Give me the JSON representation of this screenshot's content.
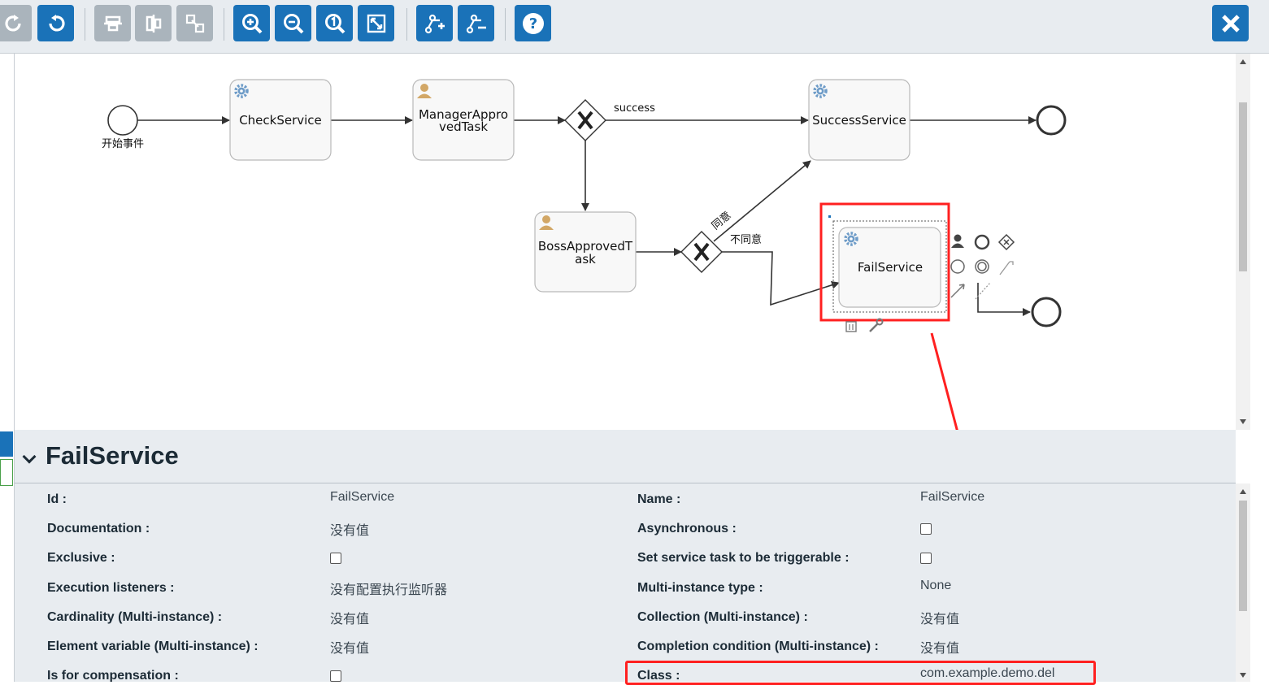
{
  "toolbar": {
    "buttons": [
      {
        "name": "redo-icon",
        "style": "grey"
      },
      {
        "name": "undo-icon",
        "style": "blue"
      },
      {
        "name": "align-horizontal-icon",
        "style": "grey"
      },
      {
        "name": "align-vertical-icon",
        "style": "grey"
      },
      {
        "name": "same-size-icon",
        "style": "grey"
      },
      {
        "name": "zoom-in-icon",
        "style": "blue"
      },
      {
        "name": "zoom-out-icon",
        "style": "blue"
      },
      {
        "name": "zoom-actual-icon",
        "style": "blue"
      },
      {
        "name": "zoom-fit-icon",
        "style": "blue"
      },
      {
        "name": "add-bendpoint-icon",
        "style": "blue"
      },
      {
        "name": "remove-bendpoint-icon",
        "style": "blue"
      },
      {
        "name": "help-icon",
        "style": "blue"
      }
    ],
    "close_icon": "close-icon"
  },
  "diagram": {
    "start_event_label": "开始事件",
    "nodes": {
      "check_service": "CheckService",
      "manager_task_line1": "ManagerAppro",
      "manager_task_line2": "vedTask",
      "boss_task_line1": "BossApprovedT",
      "boss_task_line2": "ask",
      "success_service": "SuccessService",
      "fail_service": "FailService"
    },
    "flows": {
      "success": "success",
      "agree": "同意",
      "disagree": "不同意"
    },
    "colors": {
      "highlight": "#ff2020",
      "task_fill": "#f8f8f8",
      "service_icon": "#6e9cc8",
      "user_icon": "#d2a766"
    }
  },
  "properties": {
    "title": "FailService",
    "left": [
      {
        "label": "Id :",
        "value": "FailService",
        "type": "text"
      },
      {
        "label": "Documentation :",
        "value": "没有值",
        "type": "text"
      },
      {
        "label": "Exclusive :",
        "value": "",
        "type": "checkbox"
      },
      {
        "label": "Execution listeners :",
        "value": "没有配置执行监听器",
        "type": "text"
      },
      {
        "label": "Cardinality (Multi-instance) :",
        "value": "没有值",
        "type": "text"
      },
      {
        "label": "Element variable (Multi-instance) :",
        "value": "没有值",
        "type": "text"
      },
      {
        "label": "Is for compensation :",
        "value": "",
        "type": "checkbox"
      }
    ],
    "right": [
      {
        "label": "Name :",
        "value": "FailService",
        "type": "text"
      },
      {
        "label": "Asynchronous :",
        "value": "",
        "type": "checkbox"
      },
      {
        "label": "Set service task to be triggerable :",
        "value": "",
        "type": "checkbox"
      },
      {
        "label": "Multi-instance type :",
        "value": "None",
        "type": "text"
      },
      {
        "label": "Collection (Multi-instance) :",
        "value": "没有值",
        "type": "text"
      },
      {
        "label": "Completion condition (Multi-instance) :",
        "value": "没有值",
        "type": "text"
      },
      {
        "label": "Class :",
        "value": "com.example.demo.del",
        "type": "text"
      }
    ]
  }
}
